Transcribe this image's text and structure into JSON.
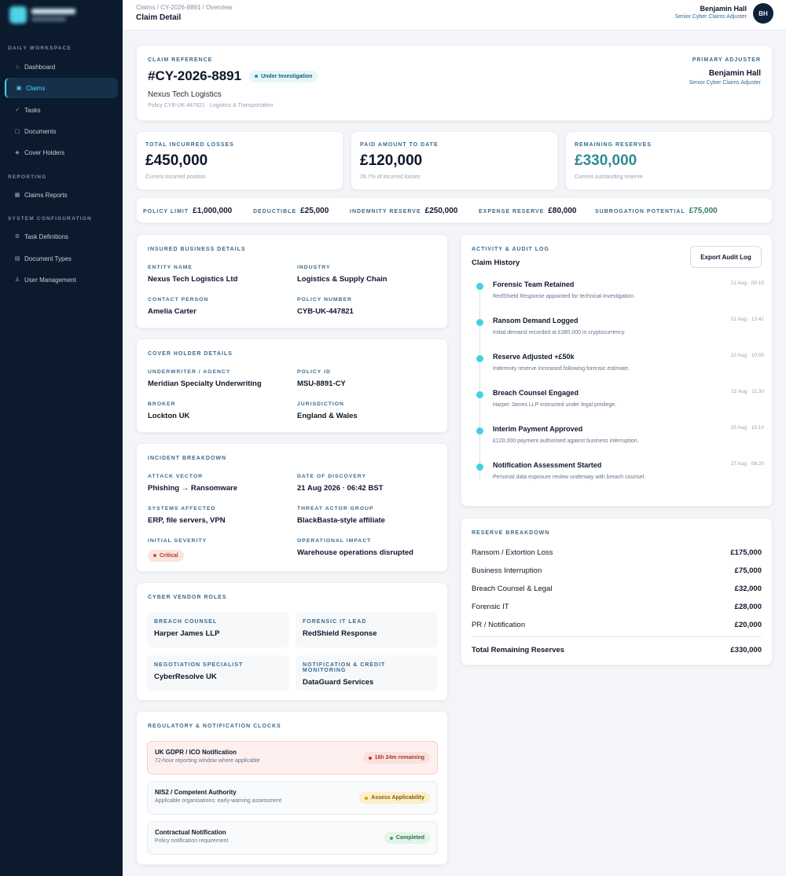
{
  "sidebar": {
    "sections": [
      {
        "label": "DAILY WORKSPACE"
      },
      {
        "label": "REPORTING"
      },
      {
        "label": "SYSTEM CONFIGURATION"
      }
    ],
    "items": [
      {
        "label": "Dashboard",
        "icon": "home-icon",
        "glyph": "⌂"
      },
      {
        "label": "Claims",
        "icon": "claims-icon",
        "glyph": "▣"
      },
      {
        "label": "Tasks",
        "icon": "check-icon",
        "glyph": "✓"
      },
      {
        "label": "Documents",
        "icon": "document-icon",
        "glyph": "▢"
      },
      {
        "label": "Cover Holders",
        "icon": "diamond-icon",
        "glyph": "◈"
      },
      {
        "label": "Claims Reports",
        "icon": "report-icon",
        "glyph": "▦"
      },
      {
        "label": "Task Definitions",
        "icon": "gear-icon",
        "glyph": "⚙"
      },
      {
        "label": "Document Types",
        "icon": "stack-icon",
        "glyph": "▤"
      },
      {
        "label": "User Management",
        "icon": "user-icon",
        "glyph": "♙"
      }
    ]
  },
  "header": {
    "breadcrumb": "Claims / CY-2026-8891 / Overview",
    "title": "Claim Detail",
    "user_name": "Benjamin Hall",
    "user_role": "Senior Cyber Claims Adjuster",
    "avatar_initials": "BH"
  },
  "claim": {
    "ref_label": "CLAIM REFERENCE",
    "ref": "#CY-2026-8891",
    "status": "Under Investigation",
    "company": "Nexus Tech Logistics",
    "policy_line": "Policy CYB-UK-447821 · Logistics & Transportation",
    "adjuster_label": "PRIMARY ADJUSTER",
    "adjuster_name": "Benjamin Hall",
    "adjuster_role": "Senior Cyber Claims Adjuster"
  },
  "stats": [
    {
      "label": "TOTAL INCURRED LOSSES",
      "value": "£450,000",
      "sub": "Current incurred position"
    },
    {
      "label": "PAID AMOUNT TO DATE",
      "value": "£120,000",
      "sub": "26.7% of incurred losses"
    },
    {
      "label": "REMAINING RESERVES",
      "value": "£330,000",
      "sub": "Current outstanding reserve"
    }
  ],
  "limits": [
    {
      "label": "POLICY LIMIT",
      "value": "£1,000,000"
    },
    {
      "label": "DEDUCTIBLE",
      "value": "£25,000"
    },
    {
      "label": "INDEMNITY RESERVE",
      "value": "£250,000"
    },
    {
      "label": "EXPENSE RESERVE",
      "value": "£80,000"
    },
    {
      "label": "SUBROGATION POTENTIAL",
      "value": "£75,000"
    }
  ],
  "insured": {
    "title": "INSURED BUSINESS DETAILS",
    "fields": [
      {
        "label": "ENTITY NAME",
        "value": "Nexus Tech Logistics Ltd"
      },
      {
        "label": "INDUSTRY",
        "value": "Logistics & Supply Chain"
      },
      {
        "label": "CONTACT PERSON",
        "value": "Amelia Carter"
      },
      {
        "label": "POLICY NUMBER",
        "value": "CYB-UK-447821"
      }
    ]
  },
  "coverholder": {
    "title": "COVER HOLDER DETAILS",
    "fields": [
      {
        "label": "UNDERWRITER / AGENCY",
        "value": "Meridian Specialty Underwriting"
      },
      {
        "label": "POLICY ID",
        "value": "MSU-8891-CY"
      },
      {
        "label": "BROKER",
        "value": "Lockton UK"
      },
      {
        "label": "JURISDICTION",
        "value": "England & Wales"
      }
    ]
  },
  "incident": {
    "title": "INCIDENT BREAKDOWN",
    "fields": [
      {
        "label": "ATTACK VECTOR",
        "value": "Phishing → Ransomware"
      },
      {
        "label": "DATE OF DISCOVERY",
        "value": "21 Aug 2026 · 06:42 BST"
      },
      {
        "label": "SYSTEMS AFFECTED",
        "value": "ERP, file servers, VPN"
      },
      {
        "label": "THREAT ACTOR GROUP",
        "value": "BlackBasta-style affiliate"
      },
      {
        "label": "INITIAL SEVERITY",
        "value": "Critical"
      },
      {
        "label": "OPERATIONAL IMPACT",
        "value": "Warehouse operations disrupted"
      }
    ]
  },
  "vendors": {
    "title": "CYBER VENDOR ROLES",
    "items": [
      {
        "label": "BREACH COUNSEL",
        "value": "Harper James LLP"
      },
      {
        "label": "FORENSIC IT LEAD",
        "value": "RedShield Response"
      },
      {
        "label": "NEGOTIATION SPECIALIST",
        "value": "CyberResolve UK"
      },
      {
        "label": "NOTIFICATION & CREDIT MONITORING",
        "value": "DataGuard Services"
      }
    ]
  },
  "clocks": {
    "title": "REGULATORY & NOTIFICATION CLOCKS",
    "items": [
      {
        "title": "UK GDPR / ICO Notification",
        "sub": "72-hour reporting window where applicable",
        "badge": "18h 24m remaining"
      },
      {
        "title": "NIS2 / Competent Authority",
        "sub": "Applicable organisations: early-warning assessment",
        "badge": "Assess Applicability"
      },
      {
        "title": "Contractual Notification",
        "sub": "Policy notification requirement",
        "badge": "Completed"
      }
    ]
  },
  "activity": {
    "label": "ACTIVITY & AUDIT LOG",
    "title": "Claim History",
    "export_label": "Export Audit Log",
    "items": [
      {
        "title": "Forensic Team Retained",
        "desc": "RedShield Response appointed for technical investigation.",
        "time": "21 Aug · 09:15"
      },
      {
        "title": "Ransom Demand Logged",
        "desc": "Initial demand recorded at £380,000 in cryptocurrency.",
        "time": "21 Aug · 13:42"
      },
      {
        "title": "Reserve Adjusted +£50k",
        "desc": "Indemnity reserve increased following forensic estimate.",
        "time": "22 Aug · 10:05"
      },
      {
        "title": "Breach Counsel Engaged",
        "desc": "Harper James LLP instructed under legal privilege.",
        "time": "22 Aug · 11:30"
      },
      {
        "title": "Interim Payment Approved",
        "desc": "£120,000 payment authorised against business interruption.",
        "time": "25 Aug · 15:10"
      },
      {
        "title": "Notification Assessment Started",
        "desc": "Personal data exposure review underway with breach counsel.",
        "time": "27 Aug · 08:20"
      }
    ]
  },
  "reserve": {
    "title": "RESERVE BREAKDOWN",
    "items": [
      {
        "label": "Ransom / Extortion Loss",
        "value": "£175,000"
      },
      {
        "label": "Business Interruption",
        "value": "£75,000"
      },
      {
        "label": "Breach Counsel & Legal",
        "value": "£32,000"
      },
      {
        "label": "Forensic IT",
        "value": "£28,000"
      },
      {
        "label": "PR / Notification",
        "value": "£20,000"
      }
    ],
    "total_label": "Total Remaining Reserves",
    "total_value": "£330,000"
  },
  "colors": {
    "accent": "#4fd3e8",
    "sidebar_bg": "#0b1a2c",
    "remaining_reserves": "#2f8c95",
    "subrogation": "#2f7d66"
  }
}
